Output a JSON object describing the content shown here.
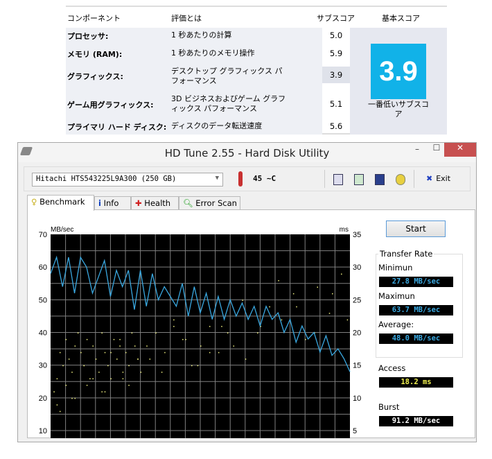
{
  "wei": {
    "headers": {
      "component": "コンポーネント",
      "rating": "評価とは",
      "subscore": "サブスコア",
      "basescore": "基本スコア"
    },
    "rows": [
      {
        "component": "プロセッサ:",
        "desc": "1 秒あたりの計算",
        "score": "5.0"
      },
      {
        "component": "メモリ (RAM):",
        "desc": "1 秒あたりのメモリ操作",
        "score": "5.9"
      },
      {
        "component": "グラフィックス:",
        "desc": "デスクトップ グラフィックス パフォーマンス",
        "score": "3.9"
      },
      {
        "component": "ゲーム用グラフィックス:",
        "desc": "3D ビジネスおよびゲーム グラフィックス パフォーマンス",
        "score": "5.1"
      },
      {
        "component": "プライマリ ハード ディスク:",
        "desc": "ディスクのデータ転送速度",
        "score": "5.6"
      }
    ],
    "base_score": "3.9",
    "base_caption": "一番低いサブスコア",
    "accent": "#11b2e8"
  },
  "window": {
    "title": "HD Tune 2.55 - Hard Disk Utility",
    "minimize": "–",
    "maximize": "☐",
    "close": "✕"
  },
  "toolbar": {
    "drive": "Hitachi HTS543225L9A300 (250 GB)",
    "temperature": "45 ~C",
    "exit_label": "Exit"
  },
  "tabs": [
    {
      "label": "Benchmark",
      "icon": "bulb-icon"
    },
    {
      "label": "Info",
      "icon": "info-icon"
    },
    {
      "label": "Health",
      "icon": "health-cross-icon"
    },
    {
      "label": "Error Scan",
      "icon": "magnifier-icon"
    }
  ],
  "side": {
    "start": "Start",
    "transfer_rate": "Transfer Rate",
    "min_label": "Minimun",
    "min": "27.8 MB/sec",
    "max_label": "Maximun",
    "max": "63.7 MB/sec",
    "avg_label": "Average:",
    "avg": "48.0 MB/sec",
    "access_label": "Access",
    "access": "18.2 ms",
    "burst_label": "Burst",
    "burst": "91.2 MB/sec"
  },
  "chart_data": {
    "type": "line",
    "ylabel_left": "MB/sec",
    "ylabel_right": "ms",
    "ylim_left": [
      10,
      70
    ],
    "ylim_right": [
      5,
      35
    ],
    "yticks_left": [
      "70",
      "60",
      "50",
      "40",
      "30",
      "20",
      "10"
    ],
    "yticks_right": [
      "35",
      "30",
      "25",
      "20",
      "15",
      "10",
      "5"
    ],
    "x_percent": [
      0,
      2,
      4,
      6,
      8,
      10,
      12,
      14,
      16,
      18,
      20,
      22,
      24,
      26,
      28,
      30,
      32,
      34,
      36,
      38,
      40,
      42,
      44,
      46,
      48,
      50,
      52,
      54,
      56,
      58,
      60,
      62,
      64,
      66,
      68,
      70,
      72,
      74,
      76,
      78,
      80,
      82,
      84,
      86,
      88,
      90,
      92,
      94,
      96,
      98,
      100
    ],
    "series": [
      {
        "name": "Transfer rate (MB/sec)",
        "color": "#3aa8e0",
        "values": [
          58,
          63,
          54,
          63,
          52,
          63,
          60,
          52,
          57,
          62,
          51,
          59,
          54,
          59,
          47,
          59,
          48,
          58,
          50,
          54,
          51,
          48,
          55,
          45,
          54,
          46,
          52,
          44,
          51,
          44,
          50,
          45,
          49,
          44,
          48,
          42,
          48,
          44,
          46,
          40,
          44,
          37,
          42,
          38,
          40,
          34,
          39,
          33,
          35,
          32,
          28
        ]
      }
    ],
    "access_points": {
      "color": "#f0f080",
      "x_percent": [
        1,
        2,
        3,
        4,
        5,
        6,
        7,
        8,
        9,
        10,
        11,
        12,
        13,
        14,
        15,
        16,
        17,
        18,
        19,
        20,
        21,
        22,
        23,
        24,
        25,
        26,
        27,
        28,
        29,
        30,
        2,
        5,
        8,
        11,
        14,
        17,
        20,
        23,
        26,
        29,
        32,
        35,
        38,
        41,
        44,
        47,
        50,
        53,
        56,
        59,
        33,
        37,
        41,
        45,
        49,
        53,
        57,
        61,
        65,
        69,
        73,
        77,
        81,
        85,
        89,
        93,
        97,
        64,
        70,
        76,
        82,
        88,
        94,
        99,
        3,
        7,
        12,
        18,
        24
      ],
      "ms": [
        11,
        13,
        17,
        15,
        19,
        16,
        14,
        18,
        20,
        17,
        15,
        19,
        13,
        18,
        16,
        14,
        20,
        17,
        15,
        13,
        19,
        16,
        18,
        14,
        17,
        15,
        20,
        18,
        16,
        14,
        9,
        12,
        10,
        15,
        13,
        11,
        17,
        19,
        12,
        16,
        18,
        20,
        17,
        21,
        19,
        15,
        18,
        21,
        17,
        20,
        16,
        14,
        22,
        19,
        15,
        17,
        21,
        18,
        16,
        20,
        24,
        22,
        26,
        19,
        27,
        23,
        29,
        25,
        21,
        28,
        24,
        20,
        26,
        22,
        8,
        10,
        12,
        11,
        13
      ]
    }
  }
}
